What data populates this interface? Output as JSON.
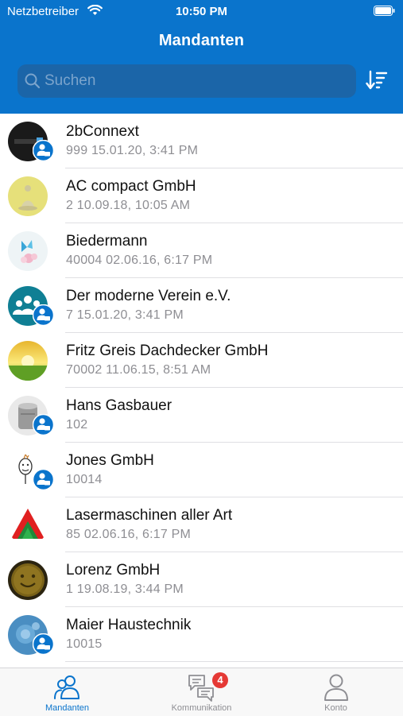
{
  "status_bar": {
    "carrier": "Netzbetreiber",
    "time": "10:50 PM"
  },
  "header": {
    "title": "Mandanten"
  },
  "search": {
    "placeholder": "Suchen"
  },
  "clients": [
    {
      "name": "2bConnext",
      "meta": "999  15.01.20, 3:41 PM",
      "badge": true
    },
    {
      "name": "AC compact GmbH",
      "meta": "2  10.09.18, 10:05 AM",
      "badge": false
    },
    {
      "name": "Biedermann",
      "meta": "40004  02.06.16, 6:17 PM",
      "badge": false
    },
    {
      "name": "Der moderne Verein e.V.",
      "meta": "7  15.01.20, 3:41 PM",
      "badge": true
    },
    {
      "name": "Fritz Greis Dachdecker GmbH",
      "meta": "70002  11.06.15, 8:51 AM",
      "badge": false
    },
    {
      "name": "Hans Gasbauer",
      "meta": "102",
      "badge": true
    },
    {
      "name": "Jones GmbH",
      "meta": "10014",
      "badge": true
    },
    {
      "name": "Lasermaschinen aller Art",
      "meta": "85  02.06.16, 6:17 PM",
      "badge": false
    },
    {
      "name": "Lorenz GmbH",
      "meta": "1  19.08.19, 3:44 PM",
      "badge": false
    },
    {
      "name": "Maier Haustechnik",
      "meta": "10015",
      "badge": true
    }
  ],
  "tabs": [
    {
      "label": "Mandanten",
      "active": true
    },
    {
      "label": "Kommunikation",
      "badge": "4"
    },
    {
      "label": "Konto"
    }
  ],
  "colors": {
    "accent": "#0a74cc",
    "header": "#0a74cc",
    "badge_red": "#e53935"
  }
}
